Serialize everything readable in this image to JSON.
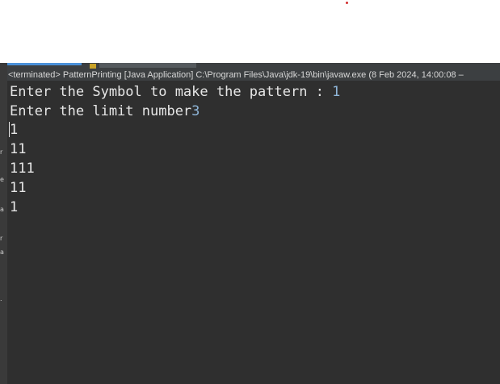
{
  "console": {
    "header": "<terminated> PatternPrinting [Java Application] C:\\Program Files\\Java\\jdk-19\\bin\\javaw.exe  (8 Feb 2024, 14:00:08 –",
    "prompt_symbol": "Enter the Symbol to make the pattern : ",
    "input_symbol": "1",
    "prompt_limit": "Enter the limit number",
    "input_limit": "3",
    "output": [
      "1",
      "11",
      "111",
      "11",
      "1"
    ]
  },
  "gutter_marks": [
    "r",
    "e",
    "a",
    "r",
    "a",
    "."
  ],
  "colors": {
    "console_bg": "#2f2f2f",
    "header_bg": "#3c3f41",
    "text": "#e6e6e6",
    "user_input": "#8fb6d9",
    "accent_dot": "#d32f2f"
  }
}
